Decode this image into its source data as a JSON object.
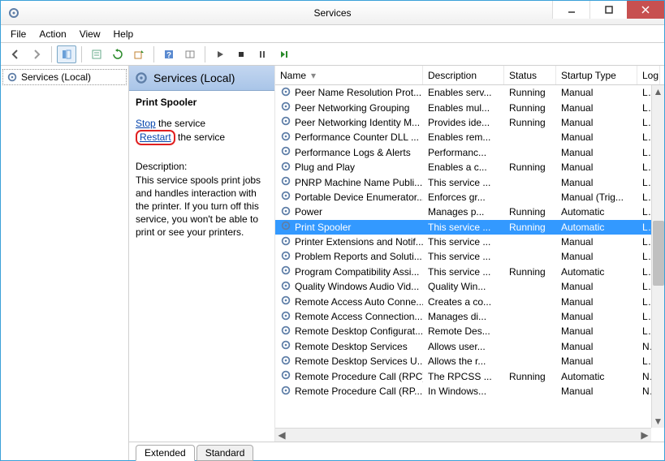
{
  "window": {
    "title": "Services"
  },
  "menu": {
    "file": "File",
    "action": "Action",
    "view": "View",
    "help": "Help"
  },
  "tree": {
    "root": "Services (Local)"
  },
  "detail": {
    "header": "Services (Local)",
    "selected_name": "Print Spooler",
    "stop_link": "Stop",
    "stop_suffix": " the service",
    "restart_link": "Restart",
    "restart_suffix": " the service",
    "desc_label": "Description:",
    "desc_text": "This service spools print jobs and handles interaction with the printer. If you turn off this service, you won't be able to print or see your printers."
  },
  "columns": {
    "name": "Name",
    "description": "Description",
    "status": "Status",
    "startup": "Startup Type",
    "logon": "Log"
  },
  "services": [
    {
      "name": "Peer Name Resolution Prot...",
      "desc": "Enables serv...",
      "status": "Running",
      "startup": "Manual",
      "logon": "Loc"
    },
    {
      "name": "Peer Networking Grouping",
      "desc": "Enables mul...",
      "status": "Running",
      "startup": "Manual",
      "logon": "Loc"
    },
    {
      "name": "Peer Networking Identity M...",
      "desc": "Provides ide...",
      "status": "Running",
      "startup": "Manual",
      "logon": "Loc"
    },
    {
      "name": "Performance Counter DLL ...",
      "desc": "Enables rem...",
      "status": "",
      "startup": "Manual",
      "logon": "Loc"
    },
    {
      "name": "Performance Logs & Alerts",
      "desc": "Performanc...",
      "status": "",
      "startup": "Manual",
      "logon": "Loc"
    },
    {
      "name": "Plug and Play",
      "desc": "Enables a c...",
      "status": "Running",
      "startup": "Manual",
      "logon": "Loc"
    },
    {
      "name": "PNRP Machine Name Publi...",
      "desc": "This service ...",
      "status": "",
      "startup": "Manual",
      "logon": "Loc"
    },
    {
      "name": "Portable Device Enumerator...",
      "desc": "Enforces gr...",
      "status": "",
      "startup": "Manual (Trig...",
      "logon": "Loc"
    },
    {
      "name": "Power",
      "desc": "Manages p...",
      "status": "Running",
      "startup": "Automatic",
      "logon": "Loc"
    },
    {
      "name": "Print Spooler",
      "desc": "This service ...",
      "status": "Running",
      "startup": "Automatic",
      "logon": "Loc",
      "selected": true
    },
    {
      "name": "Printer Extensions and Notif...",
      "desc": "This service ...",
      "status": "",
      "startup": "Manual",
      "logon": "Loc"
    },
    {
      "name": "Problem Reports and Soluti...",
      "desc": "This service ...",
      "status": "",
      "startup": "Manual",
      "logon": "Loc"
    },
    {
      "name": "Program Compatibility Assi...",
      "desc": "This service ...",
      "status": "Running",
      "startup": "Automatic",
      "logon": "Loc"
    },
    {
      "name": "Quality Windows Audio Vid...",
      "desc": "Quality Win...",
      "status": "",
      "startup": "Manual",
      "logon": "Loc"
    },
    {
      "name": "Remote Access Auto Conne...",
      "desc": "Creates a co...",
      "status": "",
      "startup": "Manual",
      "logon": "Loc"
    },
    {
      "name": "Remote Access Connection...",
      "desc": "Manages di...",
      "status": "",
      "startup": "Manual",
      "logon": "Loc"
    },
    {
      "name": "Remote Desktop Configurat...",
      "desc": "Remote Des...",
      "status": "",
      "startup": "Manual",
      "logon": "Loc"
    },
    {
      "name": "Remote Desktop Services",
      "desc": "Allows user...",
      "status": "",
      "startup": "Manual",
      "logon": "Net"
    },
    {
      "name": "Remote Desktop Services U...",
      "desc": "Allows the r...",
      "status": "",
      "startup": "Manual",
      "logon": "Loc"
    },
    {
      "name": "Remote Procedure Call (RPC)",
      "desc": "The RPCSS ...",
      "status": "Running",
      "startup": "Automatic",
      "logon": "Net"
    },
    {
      "name": "Remote Procedure Call (RP...",
      "desc": "In Windows...",
      "status": "",
      "startup": "Manual",
      "logon": "Net"
    }
  ],
  "tabs": {
    "extended": "Extended",
    "standard": "Standard"
  }
}
